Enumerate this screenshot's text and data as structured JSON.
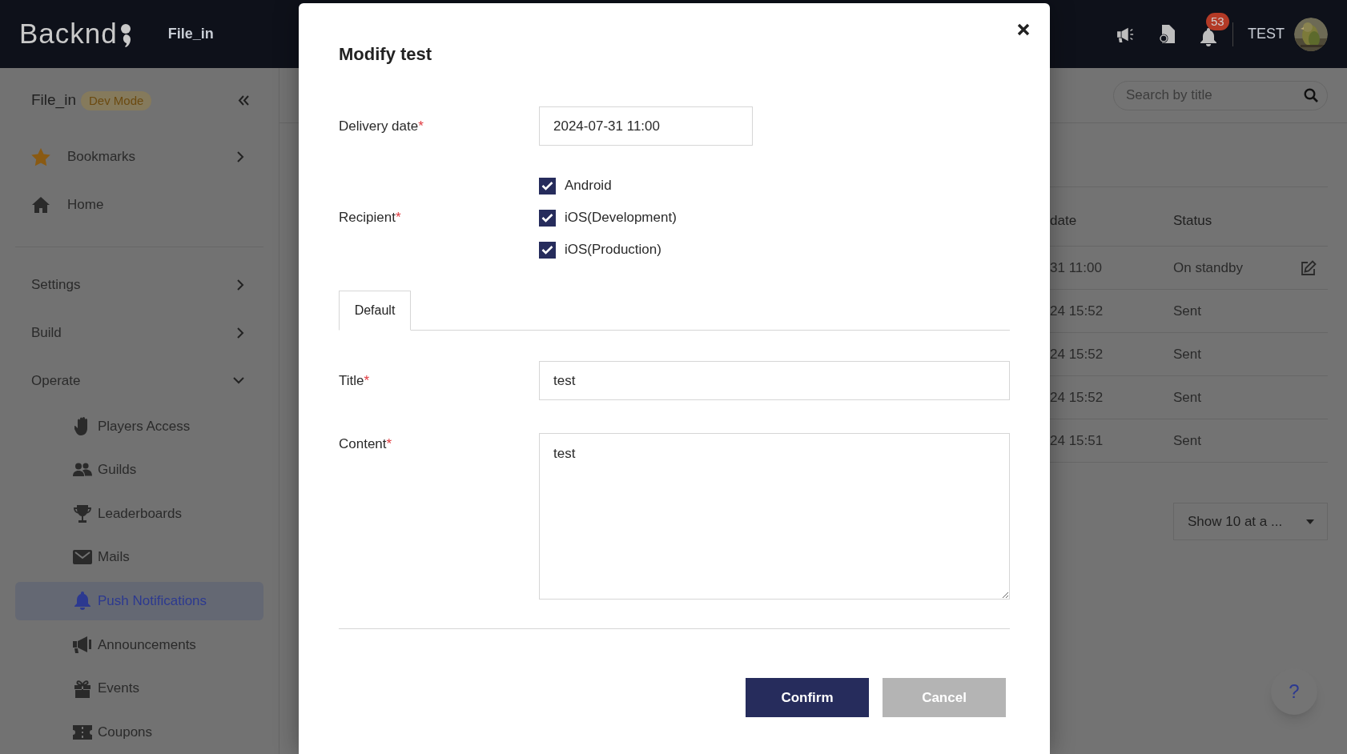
{
  "header": {
    "logo": "Backnd",
    "project": "File_in",
    "notification_count": "53",
    "user": "TEST"
  },
  "sidebar": {
    "project": "File_in",
    "badge": "Dev Mode",
    "items": [
      {
        "label": "Bookmarks",
        "expanded": false
      },
      {
        "label": "Home"
      },
      {
        "label": "Settings",
        "expanded": false
      },
      {
        "label": "Build",
        "expanded": false
      },
      {
        "label": "Operate",
        "expanded": true,
        "children": [
          {
            "label": "Players Access",
            "selected": false
          },
          {
            "label": "Guilds",
            "selected": false
          },
          {
            "label": "Leaderboards",
            "selected": false
          },
          {
            "label": "Mails",
            "selected": false
          },
          {
            "label": "Push Notifications",
            "selected": true
          },
          {
            "label": "Announcements",
            "selected": false
          },
          {
            "label": "Events",
            "selected": false
          },
          {
            "label": "Coupons",
            "selected": false
          }
        ]
      }
    ]
  },
  "main": {
    "search": {
      "placeholder": "Search by title"
    },
    "table": {
      "columns": [
        "date",
        "Status"
      ],
      "rows": [
        {
          "cells": [
            "31 11:00",
            "On standby"
          ],
          "editable": true
        },
        {
          "cells": [
            "24 15:52",
            "Sent"
          ],
          "editable": false
        },
        {
          "cells": [
            "24 15:52",
            "Sent"
          ],
          "editable": false
        },
        {
          "cells": [
            "24 15:52",
            "Sent"
          ],
          "editable": false
        },
        {
          "cells": [
            "24 15:51",
            "Sent"
          ],
          "editable": false
        }
      ]
    },
    "page_size": "Show 10 at a ...",
    "help": "?"
  },
  "modal": {
    "title": "Modify test",
    "fields": [
      {
        "label": "Delivery date",
        "required_mark": "*",
        "kind": "text",
        "value": "2024-07-31 11:00"
      },
      {
        "label": "Recipient",
        "required_mark": "*",
        "kind": "checkboxes",
        "options": [
          {
            "label": "Android",
            "checked": true
          },
          {
            "label": "iOS(Development)",
            "checked": true
          },
          {
            "label": "iOS(Production)",
            "checked": true
          }
        ]
      }
    ],
    "tabs": [
      {
        "label": "Default",
        "selected": true
      }
    ],
    "tab_fields": [
      {
        "label": "Title",
        "required_mark": "*",
        "kind": "text",
        "value": "test"
      },
      {
        "label": "Content",
        "required_mark": "*",
        "kind": "textarea",
        "value": "test"
      }
    ],
    "buttons": [
      {
        "label": "Confirm",
        "kind": "primary"
      },
      {
        "label": "Cancel",
        "kind": "secondary"
      }
    ]
  }
}
